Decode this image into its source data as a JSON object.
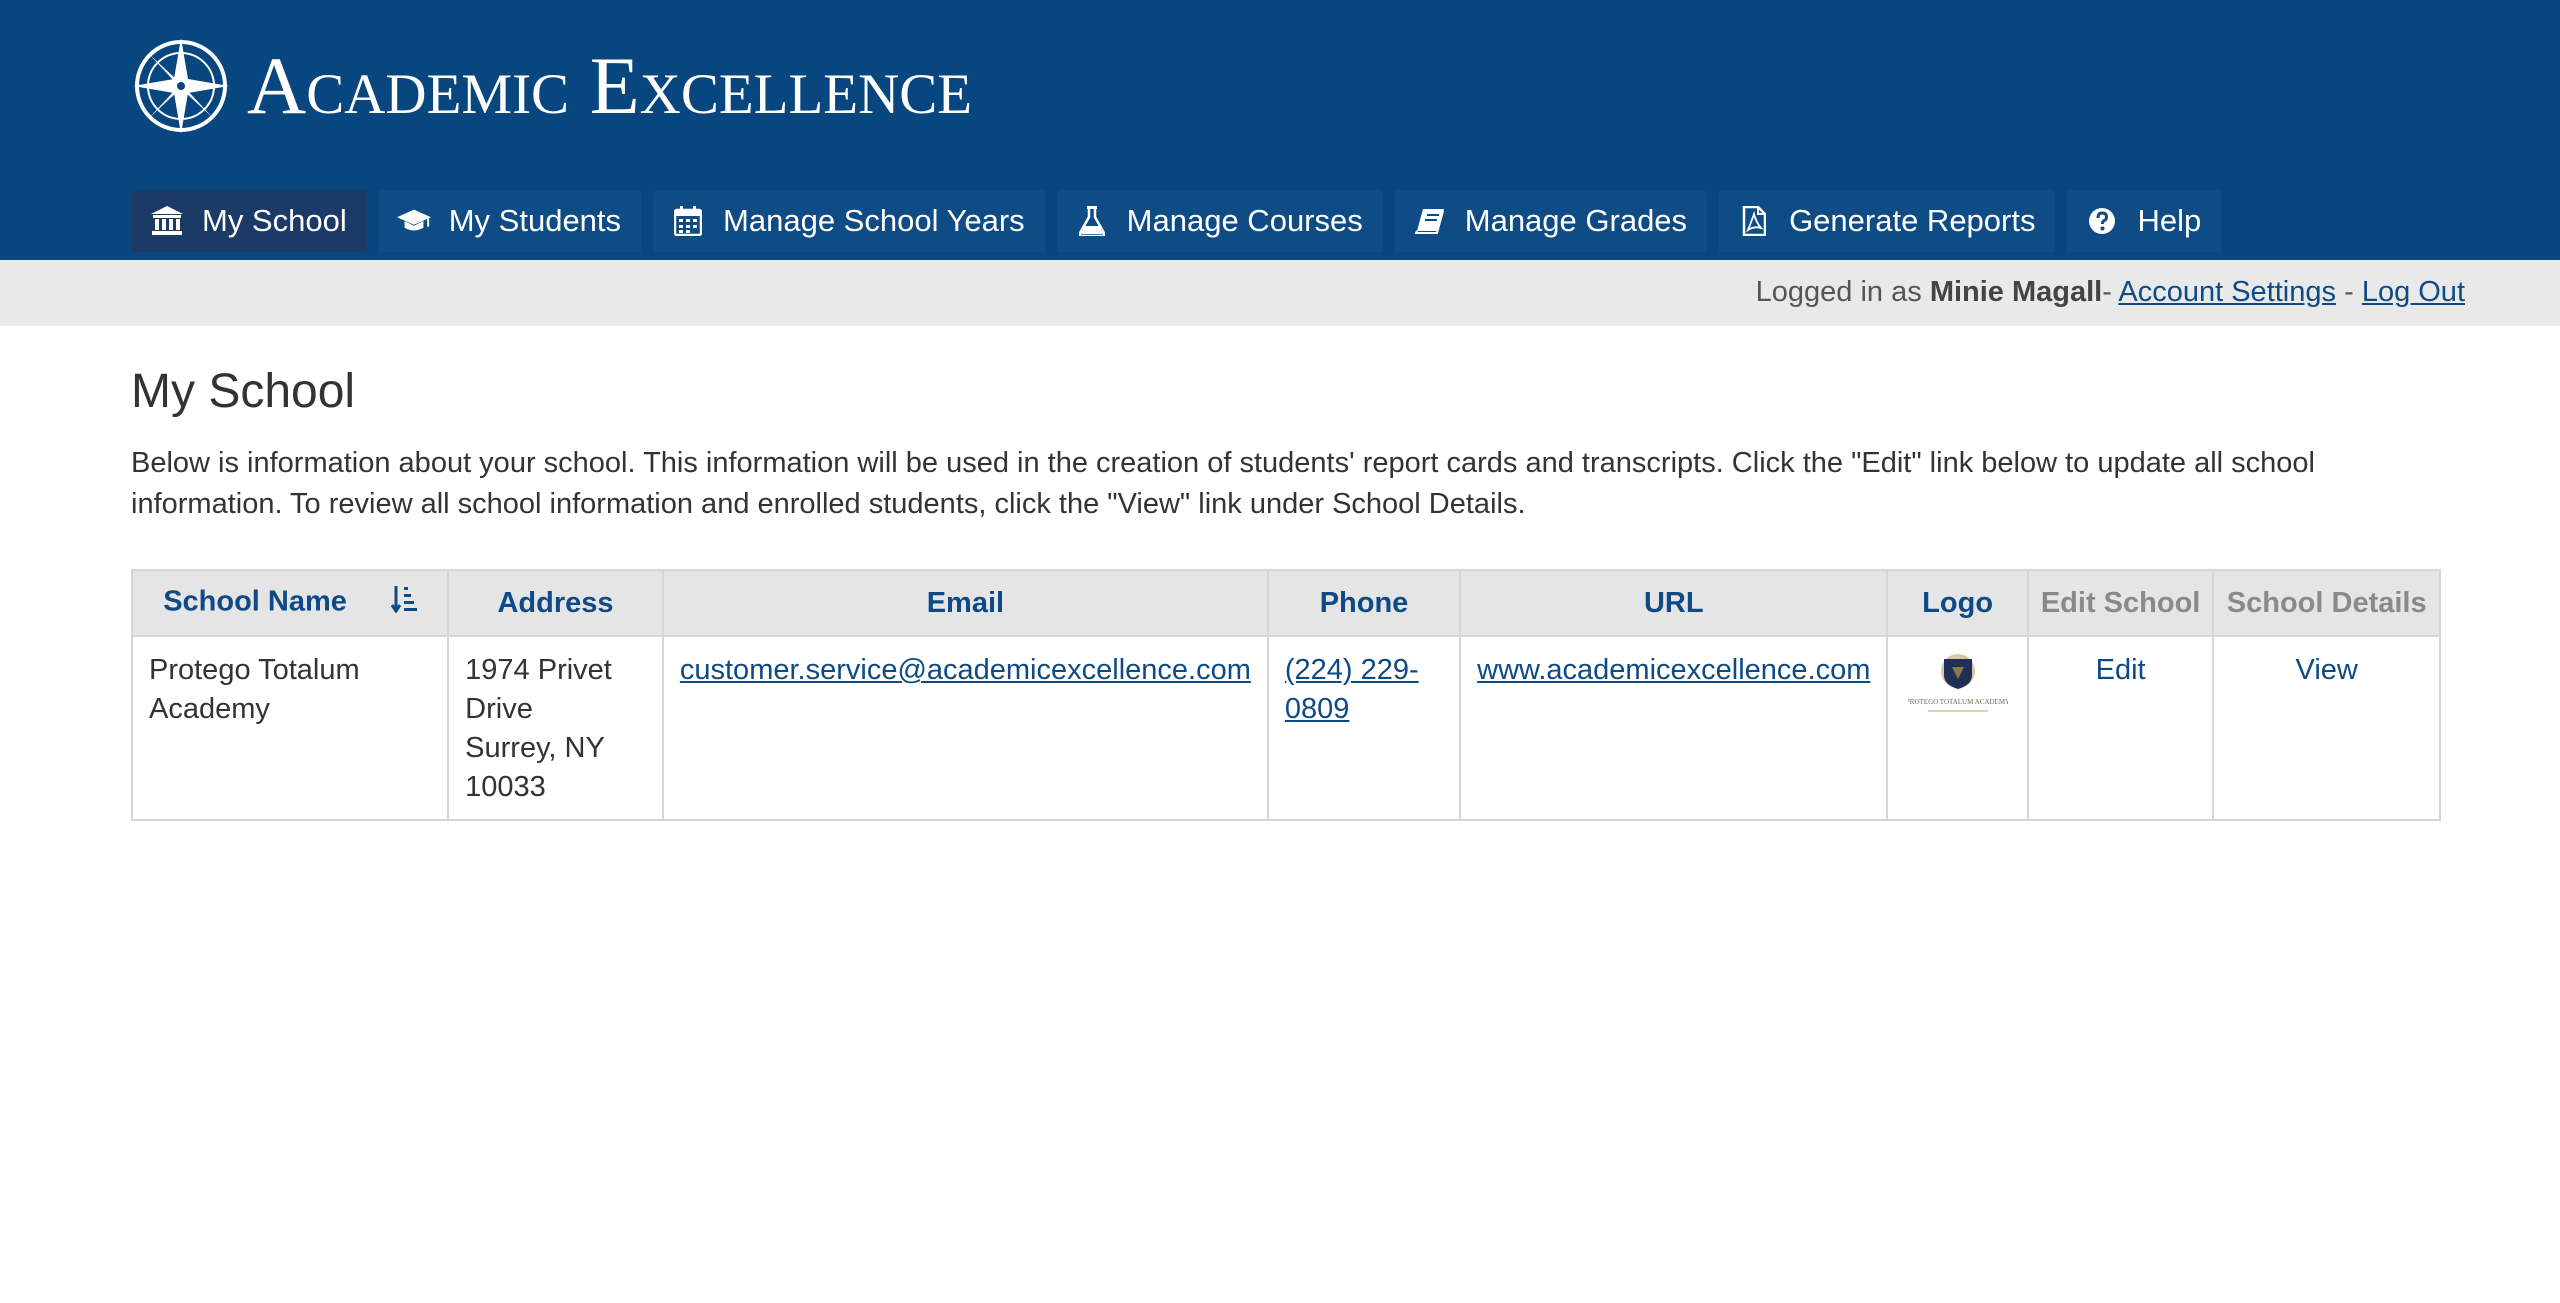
{
  "brand": {
    "name": "Academic Excellence"
  },
  "nav": [
    {
      "label": "My School",
      "icon": "bank-icon",
      "active": true
    },
    {
      "label": "My Students",
      "icon": "graduation-cap-icon",
      "active": false
    },
    {
      "label": "Manage School Years",
      "icon": "calendar-icon",
      "active": false
    },
    {
      "label": "Manage Courses",
      "icon": "flask-icon",
      "active": false
    },
    {
      "label": "Manage Grades",
      "icon": "book-icon",
      "active": false
    },
    {
      "label": "Generate Reports",
      "icon": "pdf-file-icon",
      "active": false
    },
    {
      "label": "Help",
      "icon": "question-circle-icon",
      "active": false
    }
  ],
  "userbar": {
    "prefix": "Logged in as",
    "username": "Minie Magall",
    "sep1": "-",
    "account_settings": "Account Settings",
    "sep2": "-",
    "logout": "Log Out"
  },
  "page": {
    "title": "My School",
    "intro": "Below is information about your school. This information will be used in the creation of students' report cards and transcripts. Click the \"Edit\" link below to update all school information. To review all school information and enrolled students, click the \"View\" link under School Details."
  },
  "table": {
    "headers": {
      "school_name": "School Name",
      "address": "Address",
      "email": "Email",
      "phone": "Phone",
      "url": "URL",
      "logo": "Logo",
      "edit_school": "Edit School",
      "school_details": "School Details"
    },
    "rows": [
      {
        "school_name": "Protego Totalum Academy",
        "address_line1": "1974 Privet Drive",
        "address_line2": "Surrey, NY 10033",
        "email": "customer.service@academicexcellence.com",
        "phone": "(224) 229-0809",
        "url": "www.academicexcellence.com",
        "logo_caption": "PROTEGO TOTALUM ACADEMY",
        "edit": "Edit",
        "view": "View"
      }
    ]
  },
  "colors": {
    "header_bg": "#07467f",
    "nav_bg": "#0f4c86",
    "nav_active_bg": "#1b3a66",
    "link": "#0d4a86",
    "userbar_bg": "#e9e9e9"
  }
}
